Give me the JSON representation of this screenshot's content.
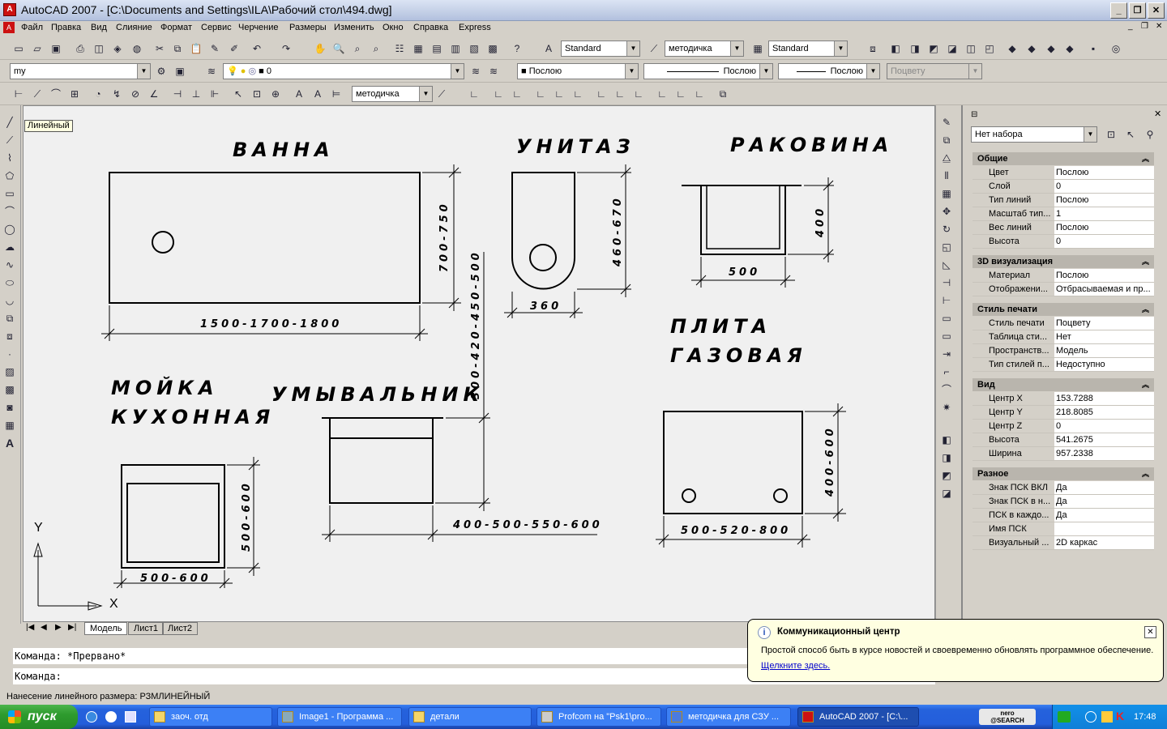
{
  "window": {
    "title": "AutoCAD 2007 - [C:\\Documents and Settings\\ILA\\Рабочий стол\\494.dwg]"
  },
  "menu": [
    "Файл",
    "Правка",
    "Вид",
    "Слияние",
    "Формат",
    "Сервис",
    "Черчение",
    "Размеры",
    "Изменить",
    "Окно",
    "Справка",
    "Express"
  ],
  "toolbars": {
    "text_style": "Standard",
    "dim_style": "методичка",
    "table_style": "Standard",
    "workspace": "my",
    "layer": "0",
    "color": "Послою",
    "linetype": "Послою",
    "lineweight": "Послою",
    "plot_style": "Поцвету",
    "dim_style2": "методичка"
  },
  "tooltip": "Линейный",
  "drawing": {
    "labels": {
      "bath": "ВАННА",
      "toilet": "УНИТАЗ",
      "sink": "РАКОВИНА",
      "stove_1": "ПЛИТА",
      "stove_2": "ГАЗОВАЯ",
      "kitchen_sink_1": "МОЙКА",
      "kitchen_sink_2": "КУХОННАЯ",
      "washbasin": "УМЫВАЛЬНИК"
    },
    "dims": {
      "bath_h": "700-750",
      "bath_w": "1500-1700-1800",
      "toilet_h": "460-670",
      "toilet_w": "360",
      "sink_h": "400",
      "sink_w": "500",
      "washbasin_h": "300-420-450-500",
      "washbasin_w": "400-500-550-600",
      "kitchen_h": "500-600",
      "kitchen_w": "500-600",
      "stove_h": "400-600",
      "stove_w": "500-520-800"
    },
    "ucs_x": "X",
    "ucs_y": "Y"
  },
  "tabs": [
    "Модель",
    "Лист1",
    "Лист2"
  ],
  "properties": {
    "selection": "Нет набора",
    "sections": [
      {
        "title": "Общие",
        "rows": [
          [
            "Цвет",
            "Послою"
          ],
          [
            "Слой",
            "0"
          ],
          [
            "Тип линий",
            "Послою"
          ],
          [
            "Масштаб тип...",
            "1"
          ],
          [
            "Вес линий",
            "Послою"
          ],
          [
            "Высота",
            "0"
          ]
        ]
      },
      {
        "title": "3D визуализация",
        "rows": [
          [
            "Материал",
            "Послою"
          ],
          [
            "Отображени...",
            "Отбрасываемая и пр..."
          ]
        ]
      },
      {
        "title": "Стиль печати",
        "rows": [
          [
            "Стиль печати",
            "Поцвету"
          ],
          [
            "Таблица сти...",
            "Нет"
          ],
          [
            "Пространств...",
            "Модель"
          ],
          [
            "Тип стилей п...",
            "Недоступно"
          ]
        ]
      },
      {
        "title": "Вид",
        "rows": [
          [
            "Центр X",
            "153.7288"
          ],
          [
            "Центр Y",
            "218.8085"
          ],
          [
            "Центр Z",
            "0"
          ],
          [
            "Высота",
            "541.2675"
          ],
          [
            "Ширина",
            "957.2338"
          ]
        ]
      },
      {
        "title": "Разное",
        "rows": [
          [
            "Знак ПСК ВКЛ",
            "Да"
          ],
          [
            "Знак ПСК в н...",
            "Да"
          ],
          [
            "ПСК в каждо...",
            "Да"
          ],
          [
            "Имя ПСК",
            ""
          ],
          [
            "Визуальный ...",
            "2D каркас"
          ]
        ]
      }
    ]
  },
  "command": {
    "line1": "Команда: *Прервано*",
    "line2": "Команда:"
  },
  "status": "Нанесение линейного размера:  РЗМЛИНЕЙНЫЙ",
  "balloon": {
    "title": "Коммуникационный центр",
    "message": "Простой способ быть в курсе новостей и своевременно обновлять программное обеспечение.",
    "link": "Щелкните здесь."
  },
  "taskbar": {
    "start": "пуск",
    "tasks": [
      "заоч. отд",
      "Image1 - Программа ...",
      "детали",
      "Profcom на \"Psk1\\pro...",
      "методичка для СЗУ ...",
      "AutoCAD 2007 - [C:\\..."
    ],
    "tray_app": "nero\n@SEARCH",
    "clock": "17:48"
  }
}
